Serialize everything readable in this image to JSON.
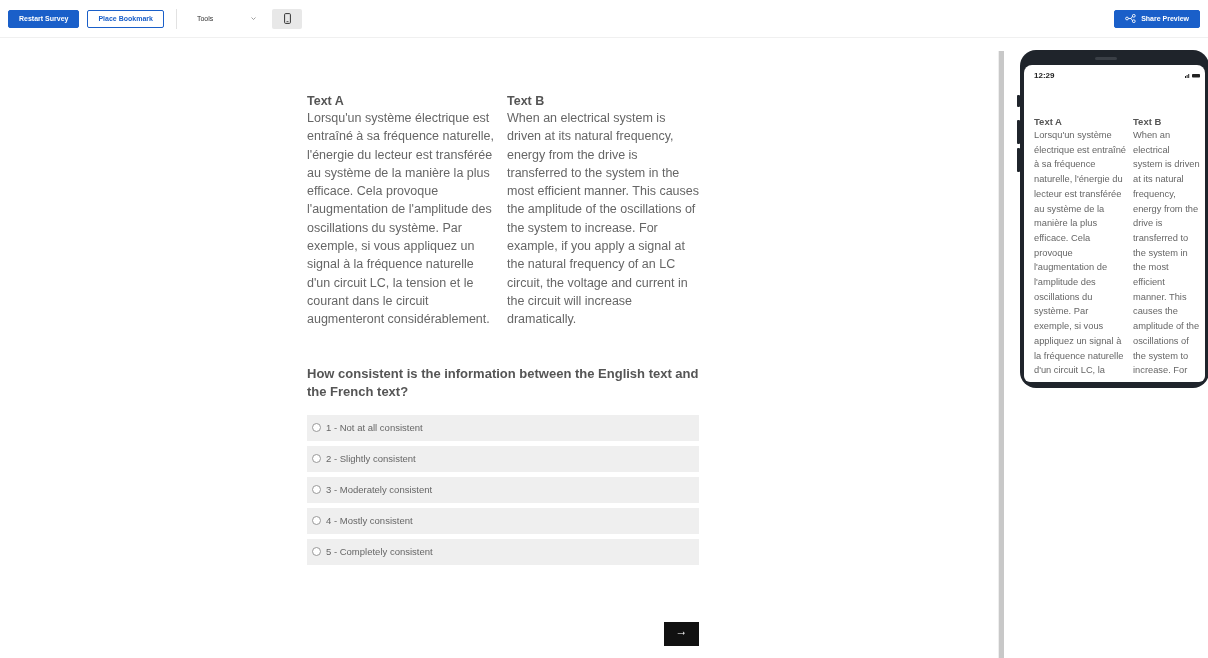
{
  "toolbar": {
    "buttons": [
      {
        "label": "Restart Survey",
        "kind": "primary"
      },
      {
        "label": "Place Bookmark",
        "kind": "outline"
      }
    ],
    "tools_menu": {
      "label": "Tools"
    },
    "device_toggle": {
      "selected": true
    },
    "share_button": {
      "label": "Share Preview"
    }
  },
  "survey": {
    "texts": [
      {
        "heading": "Text A",
        "body": "Lorsqu'un système électrique est entraîné à sa fréquence naturelle, l'énergie du lecteur est transférée au système de la manière la plus efficace. Cela provoque l'augmentation de l'amplitude des oscillations du système. Par exemple, si vous appliquez un signal à la fréquence naturelle d'un circuit LC, la tension et le courant dans le circuit augmenteront considérablement."
      },
      {
        "heading": "Text B",
        "body": "When an electrical system is driven at its natural frequency, energy from the drive is transferred to the system in the most efficient manner. This causes the amplitude of the oscillations of the system to increase. For example, if you apply a signal at the natural frequency of an LC circuit, the voltage and current in the circuit will increase dramatically."
      }
    ],
    "question": "How consistent is the information between the English text and the French text?",
    "options": [
      {
        "label": "1 - Not at all consistent",
        "selected": false
      },
      {
        "label": "2 - Slightly consistent",
        "selected": false
      },
      {
        "label": "3 - Moderately consistent",
        "selected": false
      },
      {
        "label": "4 - Mostly consistent",
        "selected": false
      },
      {
        "label": "5 - Completely consistent",
        "selected": false
      }
    ],
    "next_button": {
      "label": "→"
    }
  },
  "phone_preview": {
    "time": "12:29",
    "texts": [
      {
        "heading": "Text A",
        "body": "Lorsqu'un système électrique est entraîné à sa fréquence naturelle, l'énergie du lecteur est transférée au système de la manière la plus efficace. Cela provoque l'augmentation de l'amplitude des oscillations du système. Par exemple, si vous appliquez un signal à la fréquence naturelle d'un circuit LC, la"
      },
      {
        "heading": "Text B",
        "body": "When an electrical system is driven at its natural frequency, energy from the drive is transferred to the system in the most efficient manner. This causes the amplitude of the oscillations of the system to increase. For"
      }
    ]
  }
}
